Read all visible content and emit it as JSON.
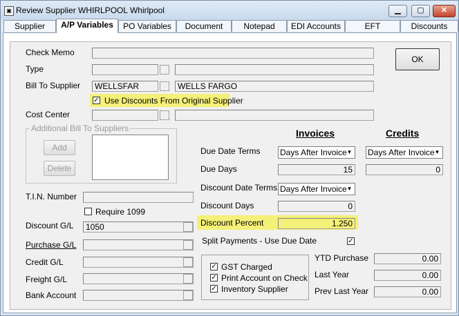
{
  "window": {
    "title": "Review Supplier WHIRLPOOL Whirlpool",
    "minimize_icon": "minimize-icon",
    "maximize_icon": "maximize-icon",
    "close_icon": "close-icon"
  },
  "tabs": [
    {
      "label": "Supplier"
    },
    {
      "label": "A/P Variables"
    },
    {
      "label": "PO Variables"
    },
    {
      "label": "Document"
    },
    {
      "label": "Notepad"
    },
    {
      "label": "EDI Accounts"
    },
    {
      "label": "EFT"
    },
    {
      "label": "Discounts"
    }
  ],
  "form": {
    "check_memo_label": "Check Memo",
    "check_memo_value": "",
    "type_label": "Type",
    "type_code": "",
    "type_desc": "",
    "bill_to_label": "Bill To Supplier",
    "bill_to_code": "WELLSFAR",
    "bill_to_name": "WELLS FARGO",
    "use_discounts_label": "Use Discounts From Original Supplier",
    "use_discounts_checked": true,
    "cost_center_label": "Cost Center",
    "cost_center_code": "",
    "cost_center_desc": "",
    "addl_group_title": "Additional Bill To Suppliers",
    "add_label": "Add",
    "delete_label": "Delete",
    "tin_label": "T.I.N. Number",
    "tin_value": "",
    "require1099_label": "Require 1099",
    "require1099_checked": false,
    "discount_gl_label": "Discount G/L",
    "discount_gl_value": "1050",
    "purchase_gl_label": "Purchase G/L",
    "purchase_gl_value": "",
    "credit_gl_label": "Credit G/L",
    "credit_gl_value": "",
    "freight_gl_label": "Freight G/L",
    "freight_gl_value": "",
    "bank_account_label": "Bank Account",
    "bank_account_value": "",
    "ok_label": "OK"
  },
  "terms": {
    "invoices_header": "Invoices",
    "credits_header": "Credits",
    "due_date_terms_label": "Due Date Terms",
    "due_date_terms_invoice": "Days After Invoice",
    "due_date_terms_credit": "Days After Invoice",
    "due_days_label": "Due Days",
    "due_days_invoice": "15",
    "due_days_credit": "0",
    "discount_date_terms_label": "Discount Date Terms",
    "discount_date_terms_invoice": "Days After Invoice",
    "discount_days_label": "Discount Days",
    "discount_days_invoice": "0",
    "discount_percent_label": "Discount Percent",
    "discount_percent_invoice": "1.250",
    "split_payments_label": "Split Payments - Use Due Date",
    "split_payments_checked": true
  },
  "options": {
    "gst_label": "GST Charged",
    "gst_checked": true,
    "print_account_label": "Print Account on Check",
    "print_account_checked": true,
    "inventory_label": "Inventory Supplier",
    "inventory_checked": true
  },
  "ytd": {
    "ytd_purchase_label": "YTD Purchase",
    "ytd_purchase_value": "0.00",
    "last_year_label": "Last Year",
    "last_year_value": "0.00",
    "prev_last_year_label": "Prev Last Year",
    "prev_last_year_value": "0.00"
  },
  "colors": {
    "highlight": "#f4f078",
    "tab_bg": "#dce7f3",
    "panel_bg": "#f0f0f0"
  }
}
